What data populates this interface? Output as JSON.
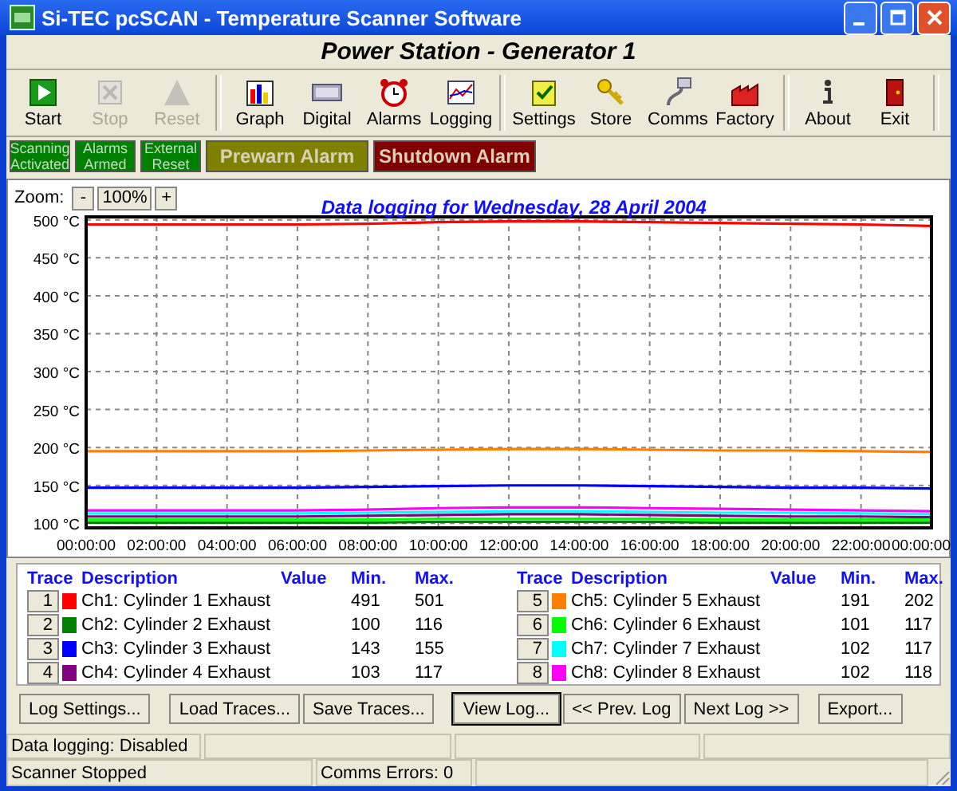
{
  "window": {
    "title": "Si-TEC pcSCAN - Temperature Scanner Software"
  },
  "heading": "Power Station - Generator 1",
  "toolbar": [
    {
      "buttons": [
        {
          "label": "Start",
          "disabled": false
        },
        {
          "label": "Stop",
          "disabled": true
        },
        {
          "label": "Reset",
          "disabled": true
        }
      ]
    },
    {
      "buttons": [
        {
          "label": "Graph",
          "disabled": false
        },
        {
          "label": "Digital",
          "disabled": false
        },
        {
          "label": "Alarms",
          "disabled": false
        },
        {
          "label": "Logging",
          "disabled": false
        }
      ]
    },
    {
      "buttons": [
        {
          "label": "Settings",
          "disabled": false
        },
        {
          "label": "Store",
          "disabled": false
        },
        {
          "label": "Comms",
          "disabled": false
        },
        {
          "label": "Factory",
          "disabled": false
        }
      ]
    },
    {
      "buttons": [
        {
          "label": "About",
          "disabled": false
        },
        {
          "label": "Exit",
          "disabled": false
        }
      ]
    }
  ],
  "indicators": [
    {
      "kind": "small",
      "label": "Scanning Activated",
      "color": "#008000"
    },
    {
      "kind": "small",
      "label": "Alarms Armed",
      "color": "#008000"
    },
    {
      "kind": "small",
      "label": "External Reset",
      "color": "#008000"
    },
    {
      "kind": "large",
      "label": "Prewarn Alarm",
      "color": "#808000"
    },
    {
      "kind": "large",
      "label": "Shutdown Alarm",
      "color": "#800000"
    }
  ],
  "zoom": {
    "label": "Zoom:",
    "minus": "-",
    "value": "100%",
    "plus": "+"
  },
  "chart_data": {
    "type": "line",
    "title": "Data logging for Wednesday, 28 April 2004",
    "grid": true,
    "categories": [
      "00:00:00",
      "02:00:00",
      "04:00:00",
      "06:00:00",
      "08:00:00",
      "10:00:00",
      "12:00:00",
      "14:00:00",
      "16:00:00",
      "18:00:00",
      "20:00:00",
      "22:00:00",
      "00:00:00"
    ],
    "ylim": [
      94,
      504
    ],
    "yticks": [
      {
        "value": 100,
        "label": "100 °C"
      },
      {
        "value": 150,
        "label": "150 °C"
      },
      {
        "value": 200,
        "label": "200 °C"
      },
      {
        "value": 250,
        "label": "250 °C"
      },
      {
        "value": 300,
        "label": "300 °C"
      },
      {
        "value": 350,
        "label": "350 °C"
      },
      {
        "value": 400,
        "label": "400 °C"
      },
      {
        "value": 450,
        "label": "450 °C"
      },
      {
        "value": 500,
        "label": "500 °C"
      }
    ],
    "series": [
      {
        "name": "Ch1: Cylinder 1 Exhaust",
        "color": "#ff0000",
        "values": [
          494,
          494,
          494,
          494,
          495,
          497,
          498,
          498,
          497,
          496,
          495,
          494,
          492
        ]
      },
      {
        "name": "Ch2: Cylinder 2 Exhaust",
        "color": "#008000",
        "values": [
          101,
          101,
          101,
          101,
          101,
          102,
          102,
          102,
          102,
          101,
          101,
          101,
          101
        ]
      },
      {
        "name": "Ch3: Cylinder 3 Exhaust",
        "color": "#0000ff",
        "values": [
          147,
          147,
          147,
          147,
          148,
          149,
          150,
          150,
          149,
          148,
          147,
          147,
          146
        ]
      },
      {
        "name": "Ch4: Cylinder 4 Exhaust",
        "color": "#800080",
        "values": [
          109,
          109,
          109,
          109,
          110,
          111,
          112,
          112,
          111,
          110,
          109,
          109,
          108
        ]
      },
      {
        "name": "Ch5: Cylinder 5 Exhaust",
        "color": "#ff8000",
        "values": [
          195,
          195,
          195,
          195,
          196,
          197,
          198,
          198,
          197,
          196,
          196,
          195,
          194
        ]
      },
      {
        "name": "Ch6: Cylinder 6 Exhaust",
        "color": "#00ff00",
        "values": [
          105,
          105,
          105,
          105,
          105,
          106,
          106,
          106,
          106,
          105,
          105,
          105,
          105
        ]
      },
      {
        "name": "Ch7: Cylinder 7 Exhaust",
        "color": "#00ffff",
        "values": [
          113,
          113,
          113,
          113,
          114,
          115,
          116,
          116,
          115,
          114,
          114,
          113,
          112
        ]
      },
      {
        "name": "Ch8: Cylinder 8 Exhaust",
        "color": "#ff00ff",
        "values": [
          117,
          117,
          117,
          117,
          118,
          120,
          121,
          121,
          120,
          119,
          118,
          117,
          116
        ]
      }
    ]
  },
  "legend": {
    "columns": [
      [
        "Trace",
        "Description",
        "Value",
        "Min.",
        "Max."
      ],
      [
        "Trace",
        "Description",
        "Value",
        "Min.",
        "Max."
      ]
    ],
    "rows": [
      {
        "trace": "1",
        "min": "491",
        "max": "501"
      },
      {
        "trace": "2",
        "min": "100",
        "max": "116"
      },
      {
        "trace": "3",
        "min": "143",
        "max": "155"
      },
      {
        "trace": "4",
        "min": "103",
        "max": "117"
      },
      {
        "trace": "5",
        "min": "191",
        "max": "202"
      },
      {
        "trace": "6",
        "min": "101",
        "max": "117"
      },
      {
        "trace": "7",
        "min": "102",
        "max": "117"
      },
      {
        "trace": "8",
        "min": "102",
        "max": "118"
      }
    ]
  },
  "buttons": [
    [
      {
        "label": "Log Settings...",
        "default": false
      }
    ],
    [
      {
        "label": "Load Traces...",
        "default": false
      },
      {
        "label": "Save Traces...",
        "default": false
      }
    ],
    [
      {
        "label": "View Log...",
        "default": true
      },
      {
        "label": "<< Prev. Log",
        "default": false
      },
      {
        "label": "Next Log >>",
        "default": false
      }
    ],
    [
      {
        "label": "Export...",
        "default": false
      }
    ]
  ],
  "status_bar": [
    [
      "Data logging: Disabled"
    ],
    [
      "Scanner Stopped",
      "Comms Errors: 0"
    ]
  ]
}
